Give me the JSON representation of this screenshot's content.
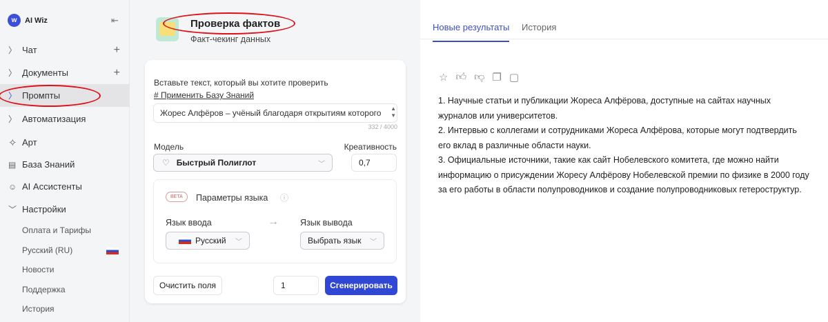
{
  "sidebar": {
    "brand": "AI Wiz",
    "items": [
      {
        "label": "Чат",
        "icon": "chevron-right"
      },
      {
        "label": "Документы",
        "icon": "chevron-right"
      },
      {
        "label": "Промпты",
        "icon": "chevron-right",
        "active": true
      },
      {
        "label": "Автоматизация",
        "icon": "chevron-right"
      },
      {
        "label": "Арт",
        "icon": "sparkle"
      },
      {
        "label": "База Знаний",
        "icon": "book"
      },
      {
        "label": "AI Ассистенты",
        "icon": "robot"
      },
      {
        "label": "Настройки",
        "icon": "chevron-down"
      }
    ],
    "sub_items": [
      "Оплата и Тарифы",
      "Русский (RU)",
      "Новости",
      "Поддержка",
      "История"
    ]
  },
  "tool": {
    "title": "Проверка фактов",
    "subtitle": "Факт-чекинг данных"
  },
  "form": {
    "prompt_label": "Вставьте текст, который вы хотите проверить",
    "kb_link": "# Применить Базу Знаний",
    "text_value": "Жорес Алфёров – учёный благодаря открытиям которого",
    "char_count": "332 / 4000",
    "model_label": "Модель",
    "model_value": "Быстрый Полиглот",
    "creativity_label": "Креативность",
    "creativity_value": "0,7",
    "lang": {
      "beta": "BETA",
      "title": "Параметры языка",
      "input_label": "Язык ввода",
      "input_value": "Русский",
      "output_label": "Язык вывода",
      "output_value": "Выбрать язык"
    },
    "clear_label": "Очистить поля",
    "count_value": "1",
    "generate_label": "Сгенерировать"
  },
  "results": {
    "tabs": [
      "Новые результаты",
      "История"
    ],
    "lines": [
      "1. Научные статьи и публикации Жореса Алфёрова, доступные на сайтах научных журналов или университетов.",
      "2. Интервью с коллегами и сотрудниками Жореса Алфёрова, которые могут подтвердить его вклад в различные области науки.",
      "3. Официальные источники, такие как сайт Нобелевского комитета, где можно найти информацию о присуждении Жоресу Алфёрову Нобелевской премии по физике в 2000 году за его работы в области полупроводников и создание полупроводниковых гетероструктур."
    ]
  },
  "colors": {
    "accent": "#3047d4",
    "annotation": "#e0101a"
  }
}
